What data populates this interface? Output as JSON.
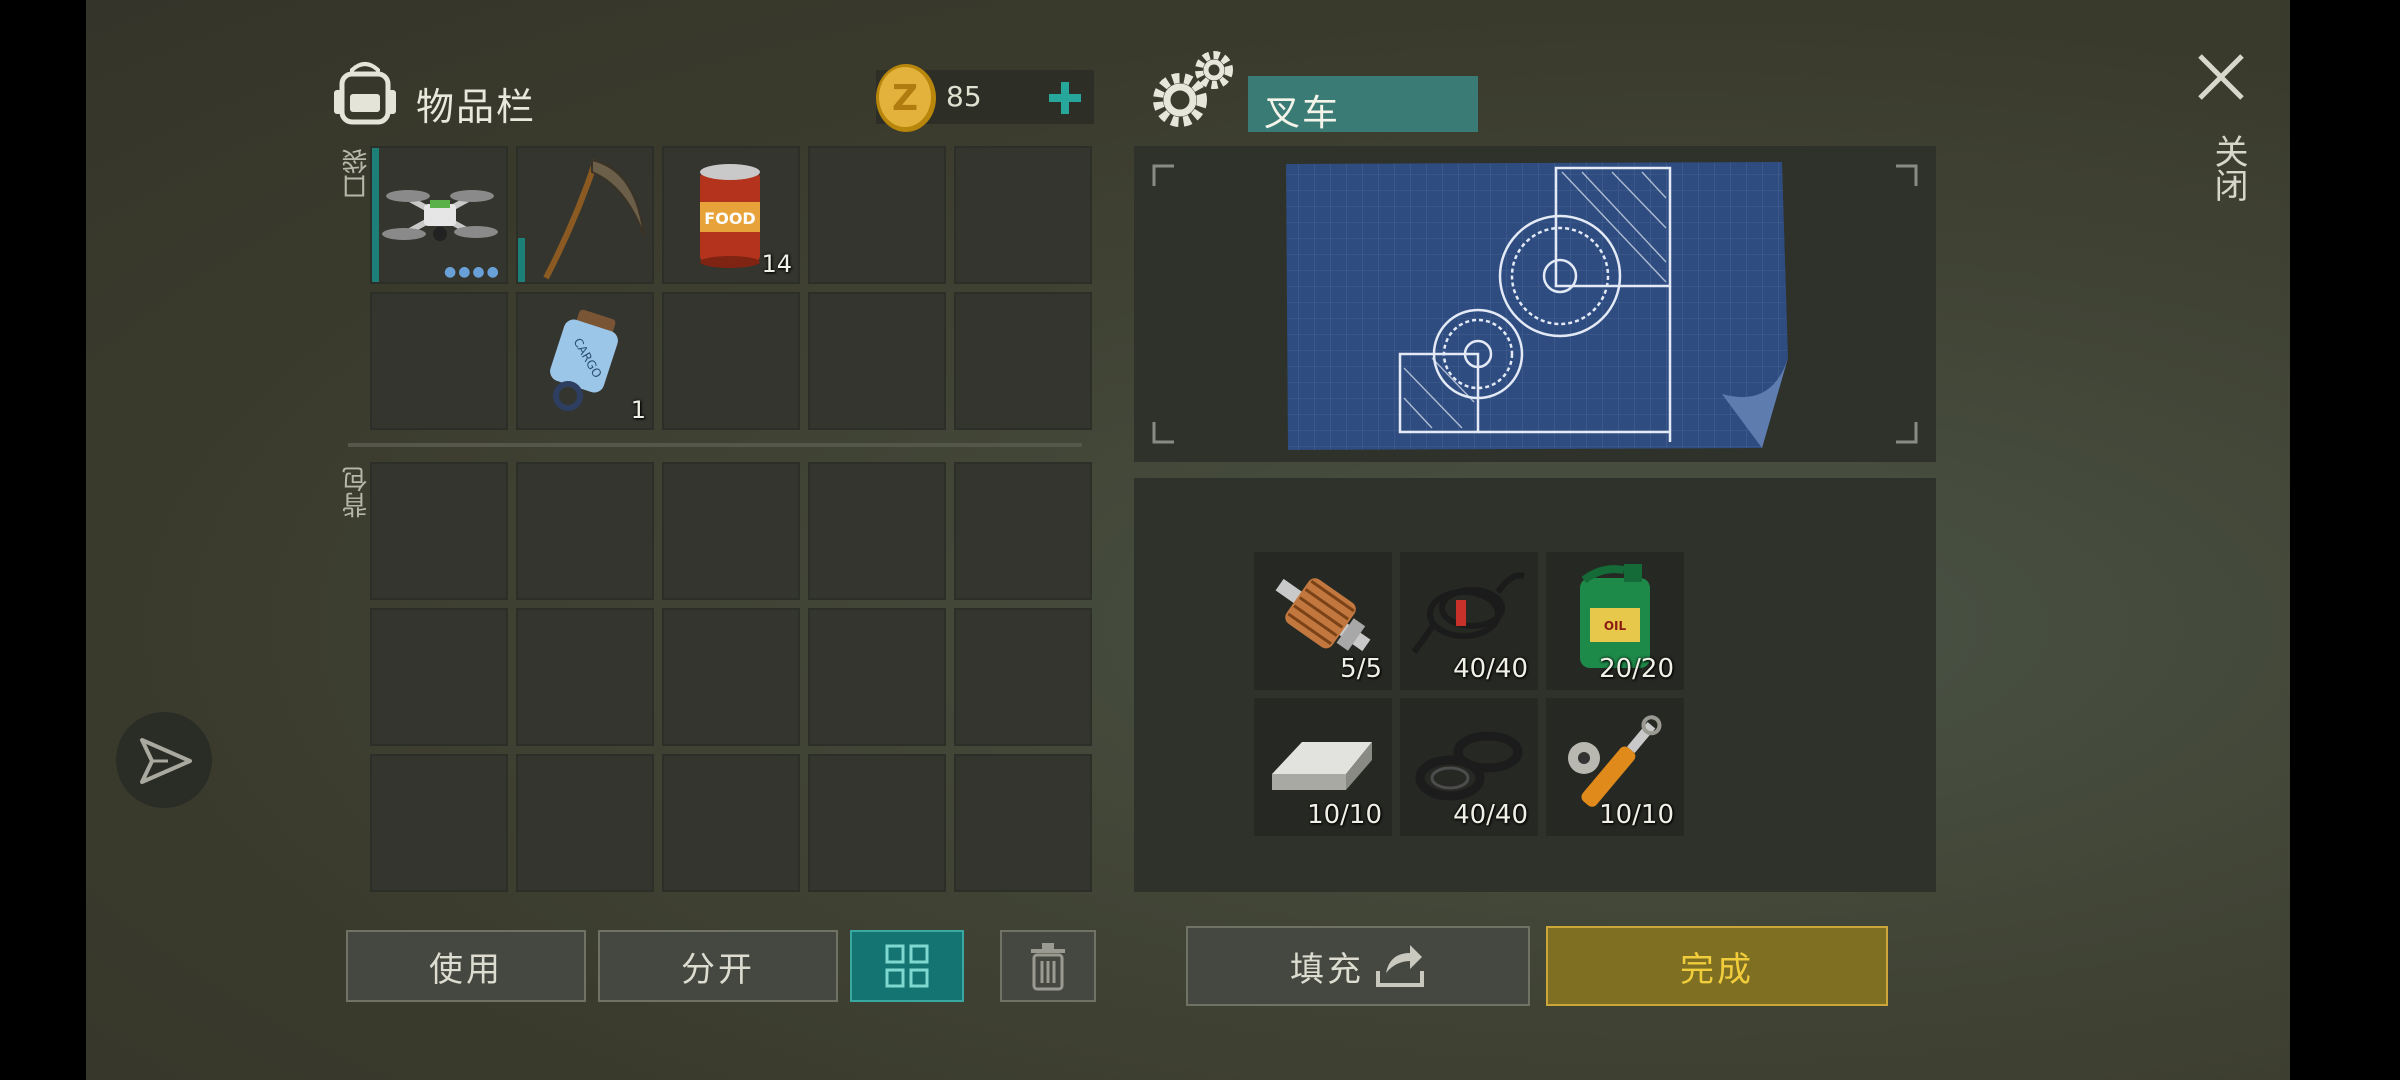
{
  "inventory": {
    "title": "物品栏",
    "coins": "85",
    "pocket_label": "口袋",
    "backpack_label": "背包",
    "pocket_items": [
      {
        "name": "drone",
        "count": ""
      },
      {
        "name": "scythe",
        "count": ""
      },
      {
        "name": "food-can",
        "count": "14"
      },
      {
        "name": "cargo-tag",
        "count": "1"
      }
    ]
  },
  "buttons": {
    "use": "使用",
    "split": "分开",
    "fill": "填充",
    "done": "完成"
  },
  "crafting": {
    "name": "叉车",
    "requirements": [
      {
        "name": "electric-motor-armature",
        "count": "5/5"
      },
      {
        "name": "wire-coil",
        "count": "40/40"
      },
      {
        "name": "motor-oil",
        "count": "20/20"
      },
      {
        "name": "steel-ingot",
        "count": "10/10"
      },
      {
        "name": "rubber-seals",
        "count": "40/40"
      },
      {
        "name": "hydraulic-cylinder",
        "count": "10/10"
      }
    ]
  },
  "close": {
    "label": "关闭"
  },
  "colors": {
    "accent_teal": "#137471",
    "gold": "#cda63a",
    "panel": "#33352e"
  }
}
